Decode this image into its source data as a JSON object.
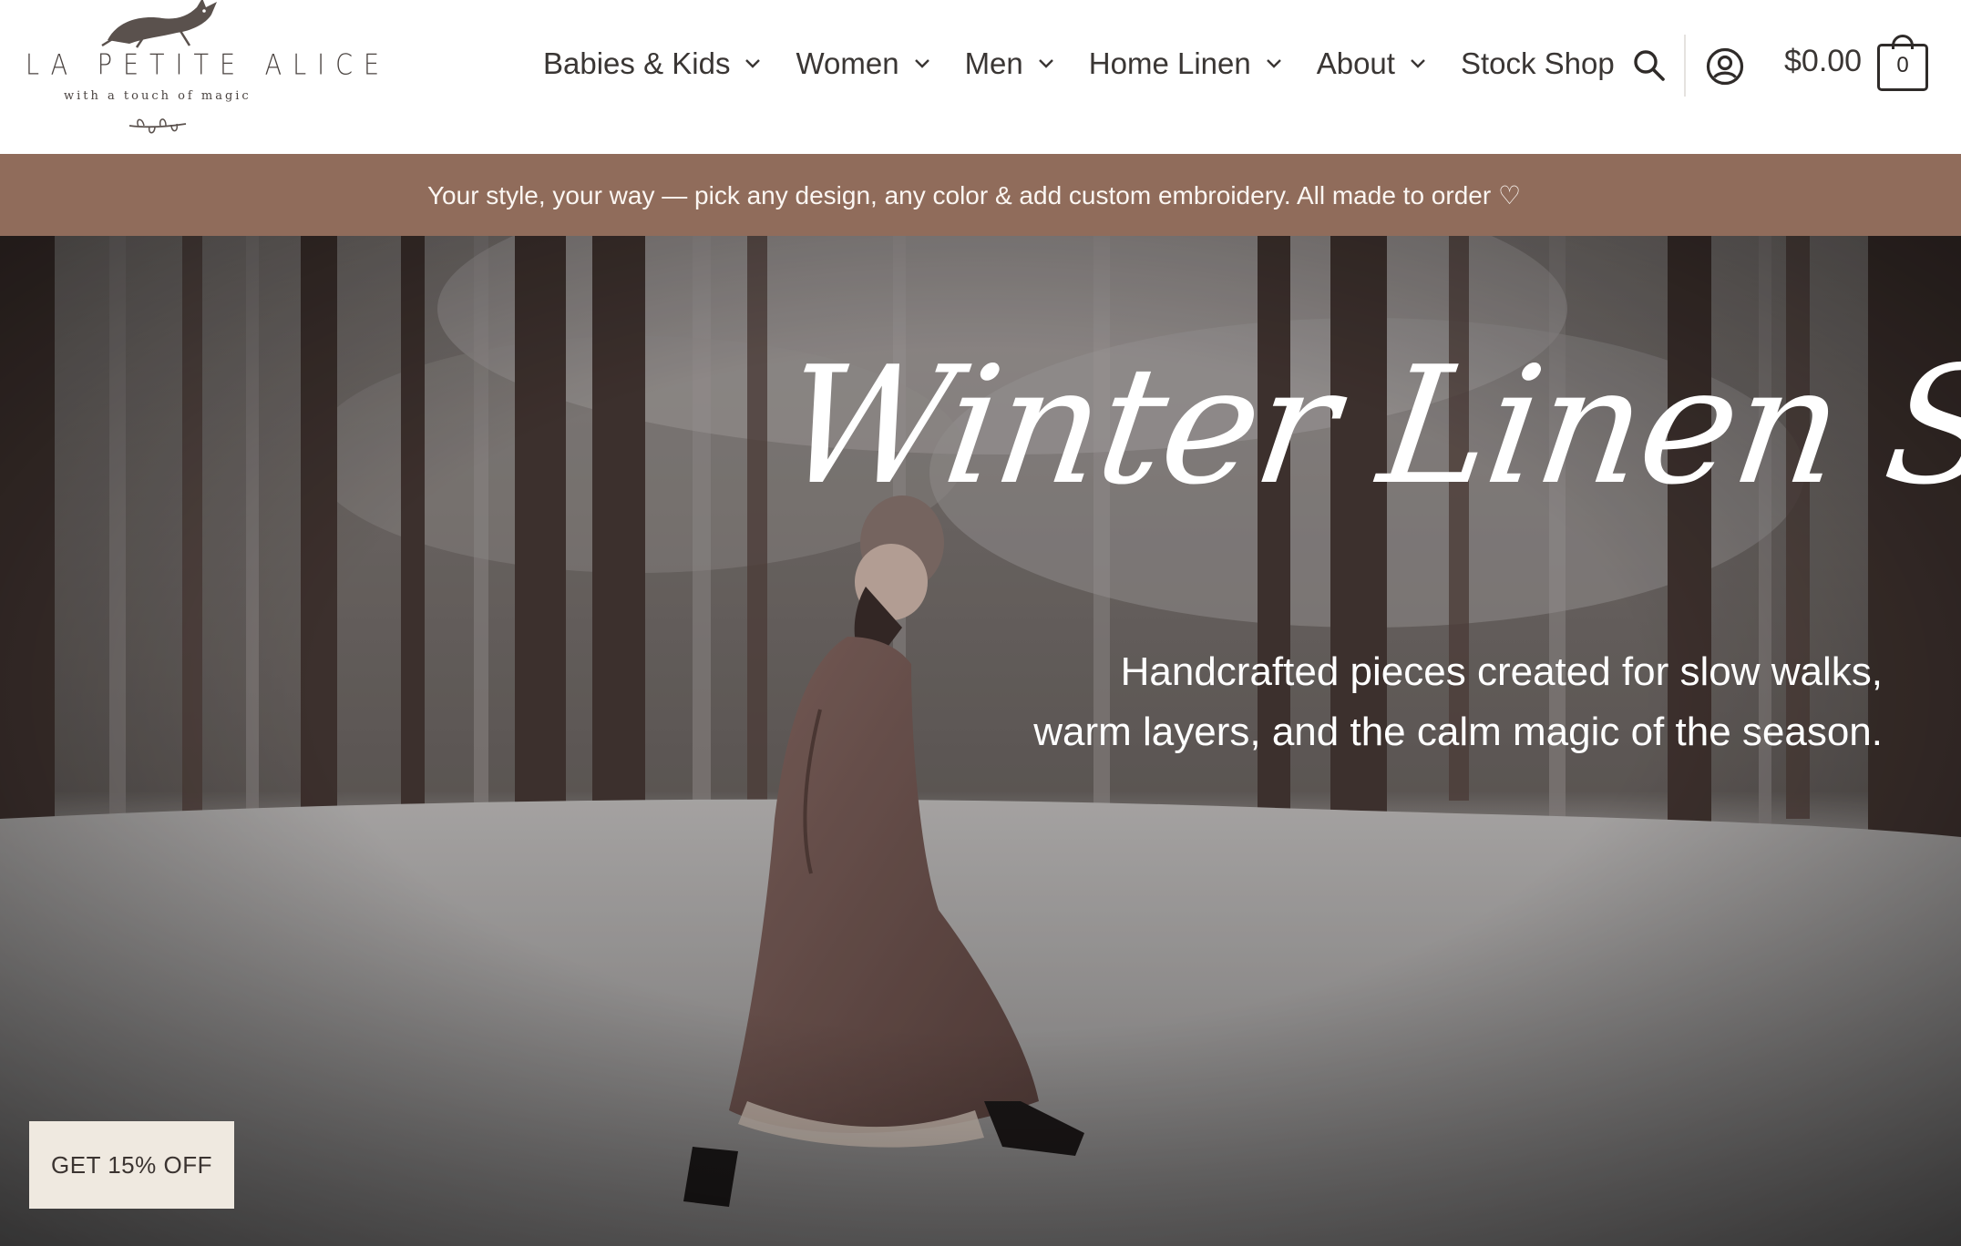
{
  "brand": {
    "name": "LA PETITE ALICE",
    "tagline": "with a touch of magic",
    "logo_icon": "hare-icon"
  },
  "nav": {
    "items": [
      {
        "label": "Babies & Kids",
        "has_dropdown": true
      },
      {
        "label": "Women",
        "has_dropdown": true
      },
      {
        "label": "Men",
        "has_dropdown": true
      },
      {
        "label": "Home Linen",
        "has_dropdown": true
      },
      {
        "label": "About",
        "has_dropdown": true
      },
      {
        "label": "Stock Shop",
        "has_dropdown": false
      }
    ],
    "search_icon": "search-icon",
    "account_icon": "account-icon"
  },
  "cart": {
    "total": "$0.00",
    "count": "0",
    "icon": "shopping-bag-icon"
  },
  "announcement": {
    "text": "Your style, your way — pick any design, any color & add custom embroidery. All made to order ♡",
    "background": "#906c5b"
  },
  "hero": {
    "title": "Winter Linen Stories",
    "subtitle_line1": "Handcrafted pieces created for slow walks,",
    "subtitle_line2": "warm layers, and the calm magic of the season."
  },
  "discount": {
    "label": "GET 15% OFF"
  },
  "colors": {
    "text_dark": "#3a3634",
    "accent_brown": "#906c5b",
    "discount_bg": "#efe9e0"
  }
}
